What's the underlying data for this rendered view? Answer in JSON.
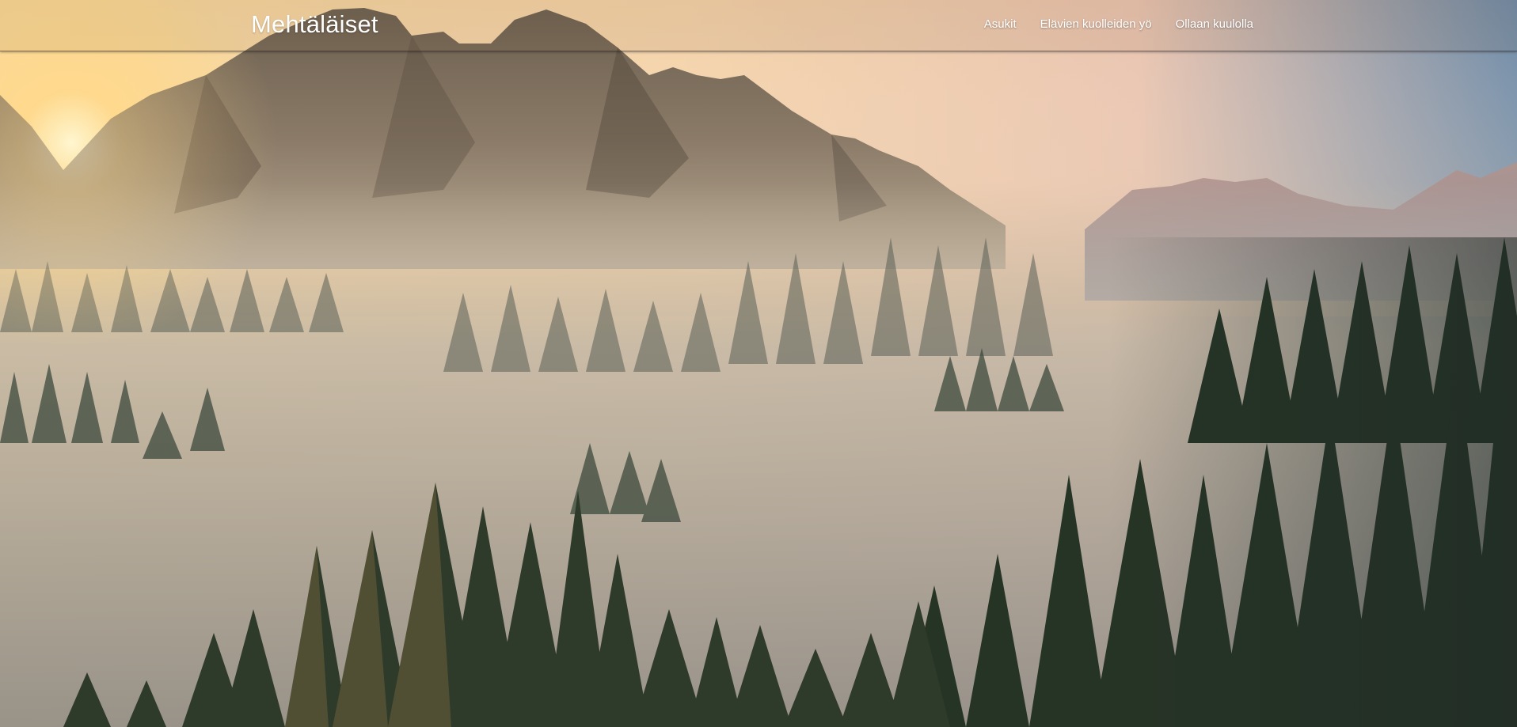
{
  "brand": {
    "title": "Mehtäläiset"
  },
  "nav": {
    "items": [
      {
        "label": "Asukit"
      },
      {
        "label": "Elävien kuolleiden yö"
      },
      {
        "label": "Ollaan kuulolla"
      }
    ]
  },
  "hero": {
    "image": "mountain-forest-fog-landscape"
  }
}
